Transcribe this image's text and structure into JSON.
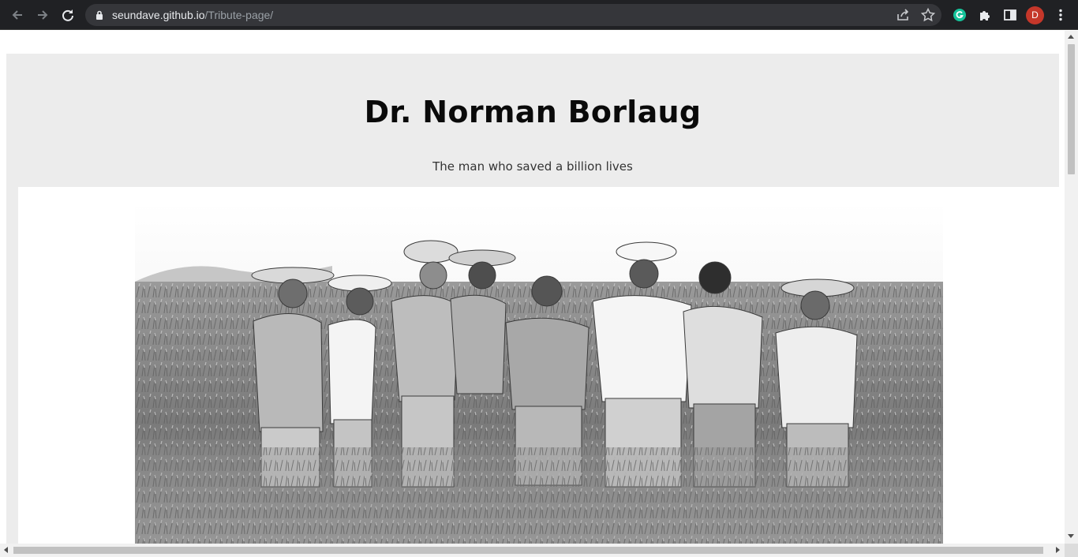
{
  "browser": {
    "url_host": "seundave.github.io",
    "url_path": "/Tribute-page/",
    "profile_initial": "D",
    "icons": {
      "back": "arrow-left-icon",
      "forward": "arrow-right-icon",
      "reload": "reload-icon",
      "lock": "lock-icon",
      "share": "share-icon",
      "bookmark": "star-icon",
      "extension_grammarly": "grammarly-icon",
      "extensions": "puzzle-icon",
      "side_panel": "side-panel-icon",
      "menu": "kebab-menu-icon"
    },
    "colors": {
      "toolbar": "#202124",
      "omnibox": "#35363a",
      "avatar": "#c5372a"
    }
  },
  "page": {
    "title": "Dr. Norman Borlaug",
    "subtitle": "The man who saved a billion lives",
    "image": {
      "description": "black-and-white-photo-men-in-wheat-field",
      "colors": {
        "sky": "#f0f0f0",
        "field": "#8a8a8a"
      }
    },
    "colors": {
      "main_bg": "#ececec",
      "image_bg": "#ffffff"
    }
  }
}
